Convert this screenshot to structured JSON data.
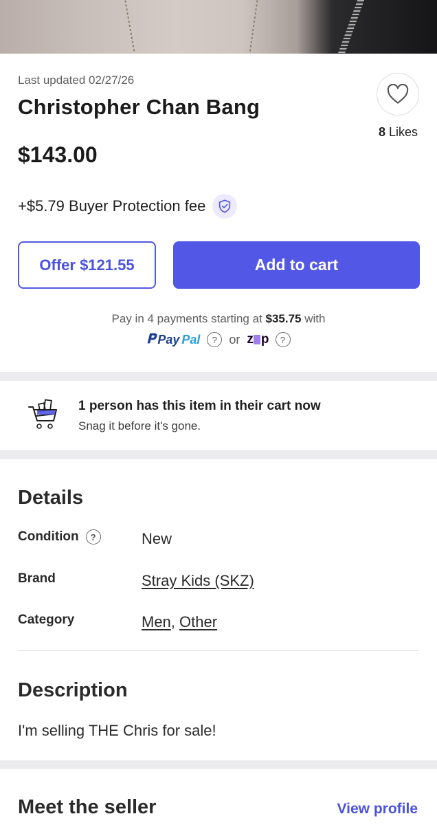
{
  "product": {
    "last_updated": "Last updated 02/27/26",
    "title": "Christopher Chan Bang",
    "likes_count": "8",
    "likes_label": "Likes",
    "price": "$143.00",
    "fee_text": "+$5.79 Buyer Protection fee"
  },
  "actions": {
    "offer_label": "Offer $121.55",
    "add_to_cart_label": "Add to cart"
  },
  "payments": {
    "line_prefix": "Pay in 4 payments starting at",
    "amount": "$35.75",
    "line_suffix": "with",
    "paypal_part1": "Pay",
    "paypal_part2": "Pal",
    "or_label": "or",
    "zip_z": "z",
    "zip_p": "p",
    "help_glyph": "?"
  },
  "cart_notice": {
    "title": "1 person has this item in their cart now",
    "subtitle": "Snag it before it's gone."
  },
  "details": {
    "heading": "Details",
    "condition_label": "Condition",
    "condition_value": "New",
    "brand_label": "Brand",
    "brand_value": "Stray Kids (SKZ)",
    "category_label": "Category",
    "category_value_1": "Men",
    "category_sep": ",",
    "category_value_2": "Other"
  },
  "description": {
    "heading": "Description",
    "text": "I'm selling THE Chris for sale!"
  },
  "seller": {
    "heading": "Meet the seller",
    "view_profile": "View profile"
  },
  "colors": {
    "accent": "#5257e6",
    "separator": "#ececee"
  },
  "icons": [
    "heart-icon",
    "shield-check-icon",
    "help-circle-icon",
    "shopping-cart-icon"
  ]
}
